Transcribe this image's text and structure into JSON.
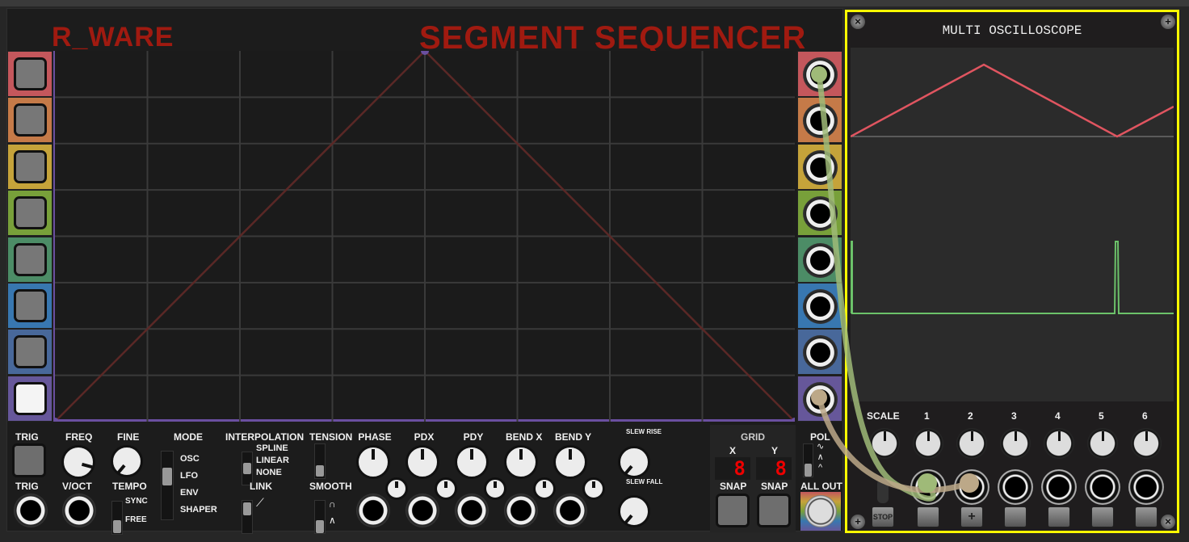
{
  "sequencer": {
    "brand": "R_WARE",
    "title": "SEGMENT SEQUENCER",
    "row_colors": [
      "#c4575c",
      "#c57a48",
      "#c5a33a",
      "#78a03a",
      "#4c8c66",
      "#3877b0",
      "#48689a",
      "#66579a"
    ],
    "trigger_pad_states": [
      "off",
      "off",
      "off",
      "off",
      "off",
      "off",
      "off",
      "on"
    ],
    "controls": {
      "trig": "TRIG",
      "freq": "FREQ",
      "fine": "FINE",
      "mode": "MODE",
      "mode_options": [
        "OSC",
        "LFO",
        "ENV",
        "SHAPER"
      ],
      "mode_selected": "LFO",
      "interpolation": "INTERPOLATION",
      "interp_options": [
        "SPLINE",
        "LINEAR",
        "NONE"
      ],
      "interp_selected": "LINEAR",
      "tension": "TENSION",
      "phase": "PHASE",
      "pdx": "PDX",
      "pdy": "PDY",
      "bend_x": "BEND X",
      "bend_y": "BEND Y",
      "slew_rise": "SLEW RISE",
      "slew_fall": "SLEW FALL",
      "trig_in": "TRIG",
      "voct": "V/OCT",
      "tempo": "TEMPO",
      "tempo_options": [
        "SYNC",
        "FREE"
      ],
      "tempo_selected": "FREE",
      "link": "LINK",
      "smooth": "SMOOTH",
      "grid": "GRID",
      "grid_x_label": "X",
      "grid_y_label": "Y",
      "grid_x_value": "8",
      "grid_y_value": "8",
      "snap_x": "SNAP",
      "snap_y": "SNAP",
      "pol": "POL",
      "all_out": "ALL OUT"
    },
    "accent": "#6a4fa0",
    "curve_color": "#5a2826"
  },
  "scope": {
    "title": "MULTI OSCILLOSCOPE",
    "scale": "SCALE",
    "channels": [
      "1",
      "2",
      "3",
      "4",
      "5",
      "6"
    ],
    "stop": "STOP",
    "plus": "+",
    "border_color": "#ffff00",
    "trace_colors": {
      "ch1": "#e05560",
      "ch2": "#6cc26a"
    }
  },
  "cables": [
    {
      "color": "#9fba78",
      "from": "sequencer out 1",
      "to": "scope input 1"
    },
    {
      "color": "#bca888",
      "from": "sequencer out 8",
      "to": "scope input 2"
    }
  ]
}
